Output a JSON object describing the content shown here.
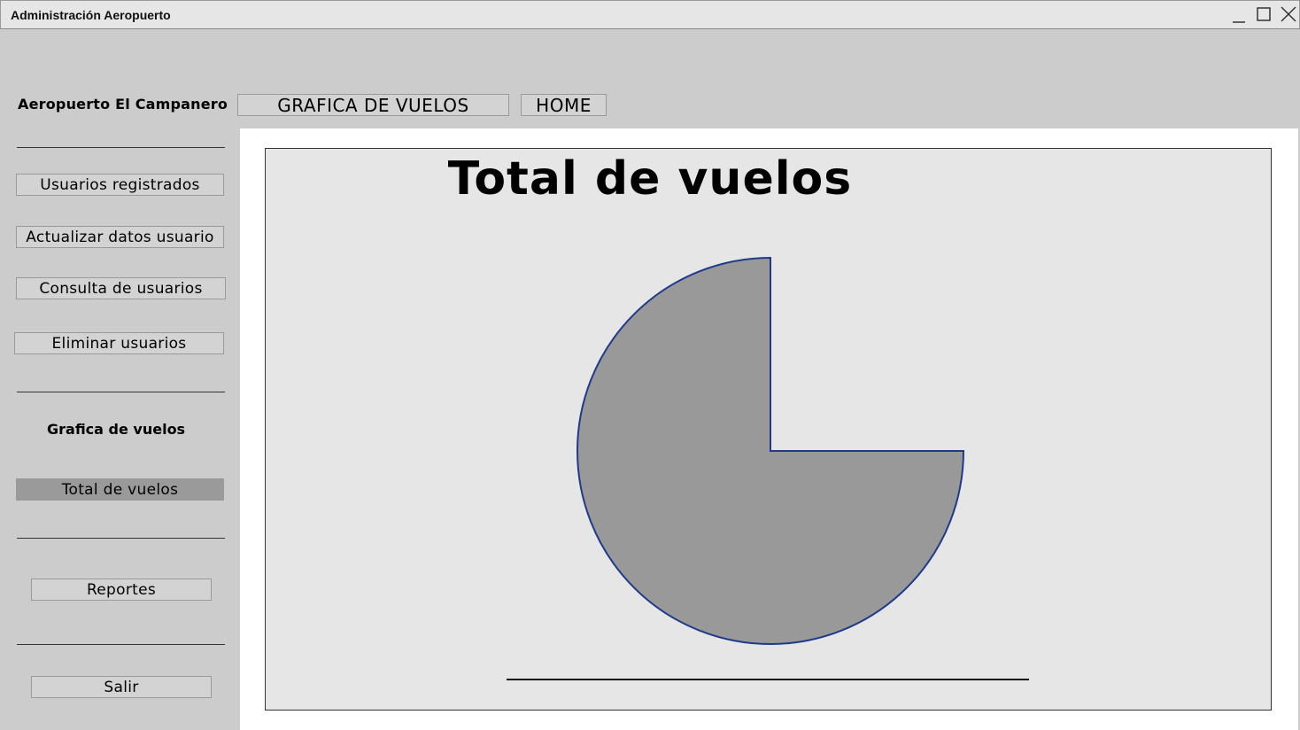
{
  "window": {
    "title": "Administración Aeropuerto",
    "controls": [
      "minimize-icon",
      "maximize-icon",
      "close-icon"
    ]
  },
  "brand": "Aeropuerto El Campanero",
  "tabs": [
    "GRAFICA DE VUELOS",
    "HOME"
  ],
  "sidebar": {
    "user_buttons": [
      "Usuarios registrados",
      "Actualizar datos usuario",
      "Consulta de usuarios",
      "Eliminar usuarios"
    ],
    "section_label": "Grafica de vuelos",
    "chart_button": "Total de vuelos",
    "reports_button": "Reportes",
    "exit_button": "Salir"
  },
  "colors": {
    "pie_fill": "#999999",
    "pie_stroke": "#1f3a8a",
    "panel_bg": "#e6e6e6",
    "active_button": "#9a9a9a"
  },
  "chart_data": {
    "type": "pie",
    "title": "Total de vuelos",
    "slices": [
      {
        "value": 75,
        "color": "#999999"
      }
    ],
    "missing_fraction": 0.25,
    "legend": "none"
  }
}
